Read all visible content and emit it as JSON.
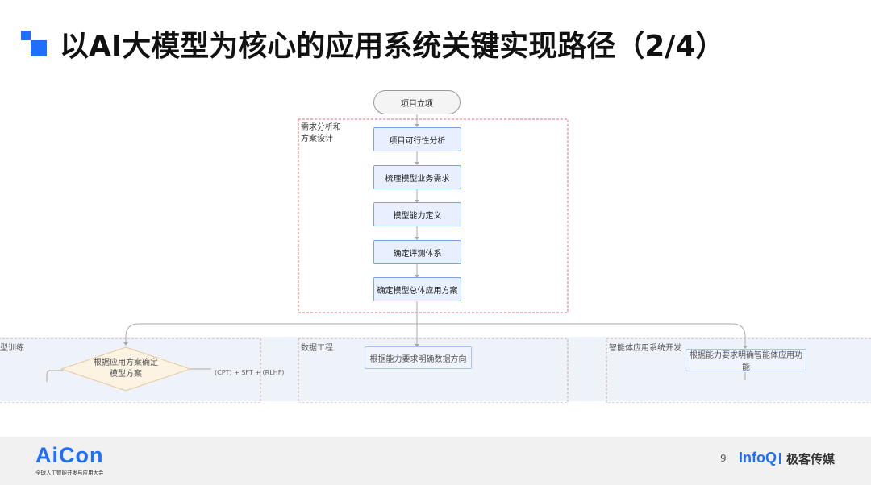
{
  "header": {
    "title": "以AI大模型为核心的应用系统关键实现路径（2/4）"
  },
  "diagram": {
    "start": "项目立项",
    "group_label": "需求分析和\n方案设计",
    "steps": [
      "项目可行性分析",
      "梳理模型业务需求",
      "模型能力定义",
      "确定评测体系",
      "确定模型总体应用方案"
    ],
    "branches": [
      {
        "label": "型训练",
        "node": "根据应用方案确定\n模型方案",
        "note": "(CPT) + SFT + (RLHF)"
      },
      {
        "label": "数据工程",
        "node": "根据能力要求明确数据方向"
      },
      {
        "label": "智能体应用系统开发",
        "node": "根据能力要求明确智能体应用功能"
      }
    ],
    "colors": {
      "node_fill": "#e8f0ff",
      "node_border": "#7aa3ea",
      "group_border": "#e57373",
      "accent": "#1f6fff"
    }
  },
  "footer": {
    "logo": "AiCon",
    "logo_sub": "全球人工智能开发与应用大会",
    "page_number": "9",
    "brand": "InfoQ",
    "company": "极客传媒"
  }
}
